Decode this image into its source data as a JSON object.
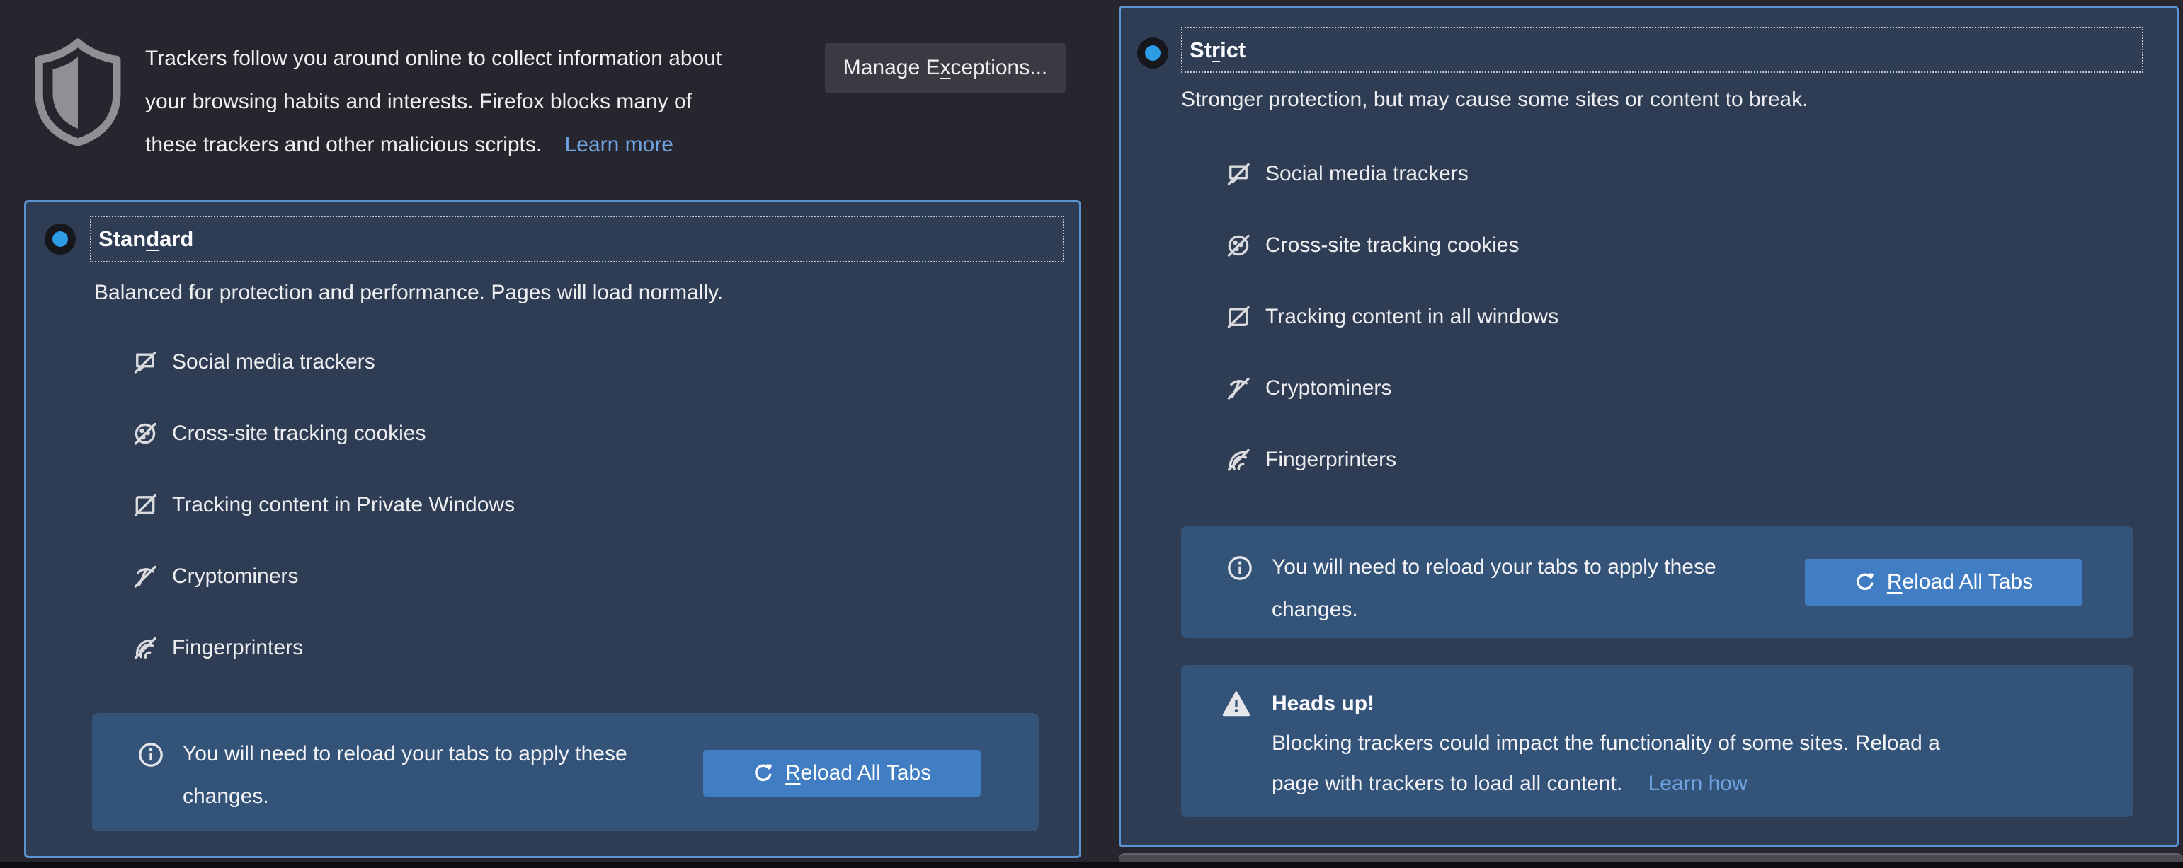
{
  "intro": {
    "line1": "Trackers follow you around online to collect information about",
    "line2": "your browsing habits and interests. Firefox blocks many of",
    "line3": "these trackers and other malicious scripts.",
    "learn_more": "Learn more",
    "manage_exceptions": {
      "pre": "Manage E",
      "key": "x",
      "post": "ceptions..."
    }
  },
  "reload_notice": {
    "line1": "You will need to reload your tabs to apply these",
    "line2": "changes.",
    "button": {
      "pre": "",
      "key": "R",
      "post": "eload All Tabs"
    }
  },
  "standard": {
    "selected": true,
    "label": {
      "pre": "Stan",
      "key": "d",
      "post": "ard"
    },
    "description": "Balanced for protection and performance. Pages will load normally.",
    "items": [
      {
        "icon": "social-media-trackers-blocked-icon",
        "label": "Social media trackers"
      },
      {
        "icon": "cross-site-cookies-blocked-icon",
        "label": "Cross-site tracking cookies"
      },
      {
        "icon": "tracking-content-blocked-icon",
        "label": "Tracking content in Private Windows"
      },
      {
        "icon": "cryptominers-blocked-icon",
        "label": "Cryptominers"
      },
      {
        "icon": "fingerprinters-blocked-icon",
        "label": "Fingerprinters"
      }
    ]
  },
  "strict": {
    "selected": true,
    "label": {
      "pre": "St",
      "key": "r",
      "post": "ict"
    },
    "description": "Stronger protection, but may cause some sites or content to break.",
    "items": [
      {
        "icon": "social-media-trackers-blocked-icon",
        "label": "Social media trackers"
      },
      {
        "icon": "cross-site-cookies-blocked-icon",
        "label": "Cross-site tracking cookies"
      },
      {
        "icon": "tracking-content-blocked-icon",
        "label": "Tracking content in all windows"
      },
      {
        "icon": "cryptominers-blocked-icon",
        "label": "Cryptominers"
      },
      {
        "icon": "fingerprinters-blocked-icon",
        "label": "Fingerprinters"
      }
    ],
    "warning": {
      "title": "Heads up!",
      "line1": "Blocking trackers could impact the functionality of some sites. Reload a",
      "line2": "page with trackers to load all content.",
      "learn_how": "Learn how"
    }
  },
  "colors": {
    "page_bg": "#27262e",
    "panel_bg": "#2e3d54",
    "panel_border": "#5a92d2",
    "notice_bg": "#345379",
    "primary_button": "#417dc3",
    "secondary_button": "#3b3a43",
    "radio_accent": "#2d9ce4",
    "link": "#6fa3e0",
    "text": "#ededf0"
  }
}
